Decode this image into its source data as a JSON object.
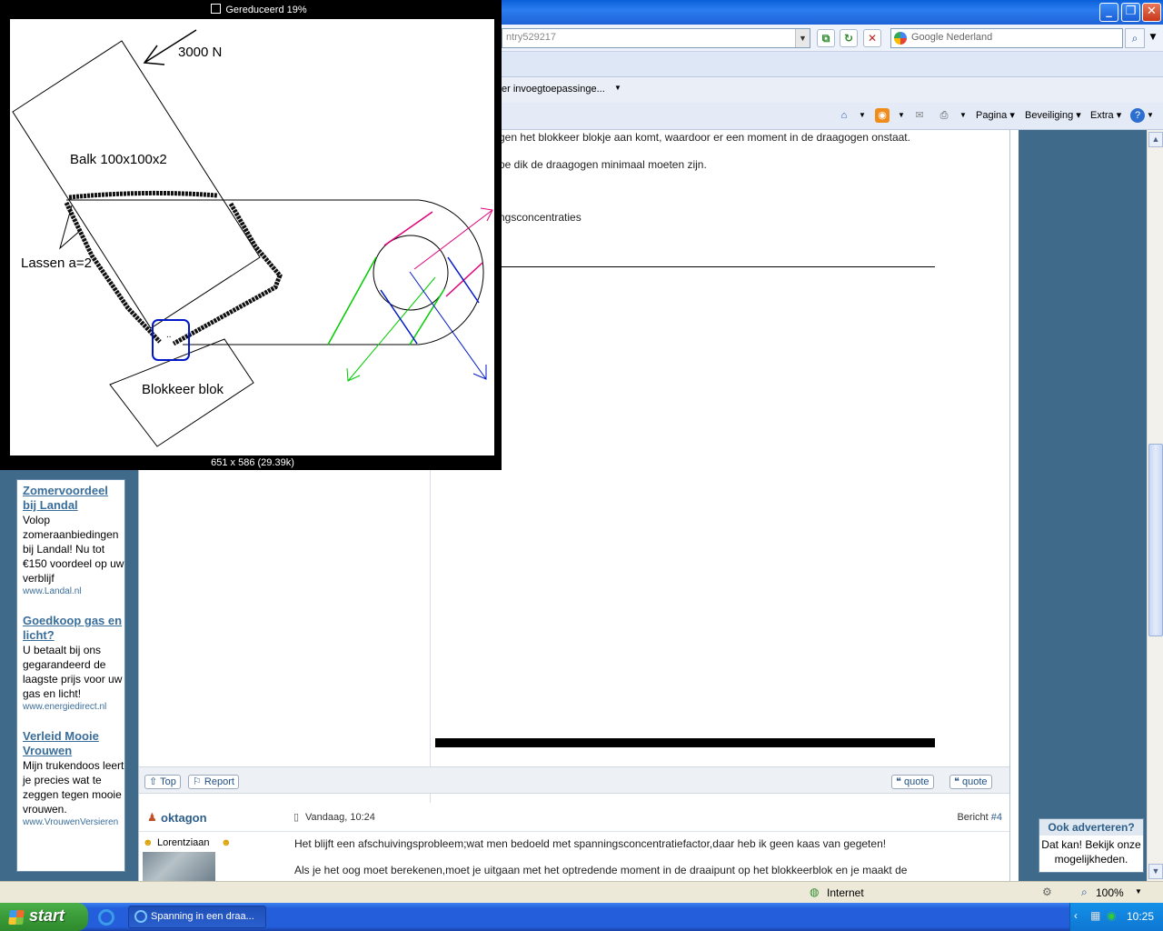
{
  "browser": {
    "address_fragment": "ntry529217",
    "search_placeholder": "Google Nederland",
    "favorites_fragment": "er invoegtoepassinge...",
    "toolbar": {
      "page": "Pagina",
      "security": "Beveiliging",
      "extra": "Extra"
    },
    "status_zone": "Internet",
    "zoom": "100%"
  },
  "post1": {
    "line1": "gen het blokkeer blokje aan komt, waardoor er een moment in de draagogen onstaat.",
    "line2": "oe dik de draagogen minimaal moeten zijn.",
    "line3": "ngsconcentraties",
    "buttons": {
      "top": "Top",
      "report": "Report",
      "quote1": "quote",
      "quote2": "quote"
    }
  },
  "post2": {
    "author": "oktagon",
    "date": "Vandaag, 10:24",
    "number_prefix": "Bericht ",
    "number": "#4",
    "rank": "Lorentziaan",
    "text1": "Het blijft een afschuivingsprobleem;wat men bedoeld met spanningsconcentratiefactor,daar heb ik geen kaas van gegeten!",
    "text2": "Als je het oog moet berekenen,moet je uitgaan met het optredende moment in de draaipunt op het blokkeerblok en je maakt de"
  },
  "ads": [
    {
      "title": "Zomervoordeel bij Landal",
      "text": "Volop zomeraanbiedingen bij Landal! Nu tot €150 voordeel op uw verblijf",
      "url": "www.Landal.nl"
    },
    {
      "title": "Goedkoop gas en licht?",
      "text": "U betaalt bij ons gegarandeerd de laagste prijs voor uw gas en licht!",
      "url": "www.energiedirect.nl"
    },
    {
      "title": "Verleid Mooie Vrouwen",
      "text": "Mijn trukendoos leert je precies wat te zeggen tegen mooie vrouwen.",
      "url": "www.VrouwenVersieren"
    }
  ],
  "advertise": {
    "title": "Ook adverteren?",
    "text": "Dat kan! Bekijk onze mogelijkheden."
  },
  "popup": {
    "title": "Gereduceerd 19%",
    "footer": "651 x 586 (29.39k)",
    "labels": {
      "force": "3000 N",
      "beam": "Balk 100x100x2",
      "welds": "Lassen a=2",
      "block": "Blokkeer blok",
      "dots": ".."
    }
  },
  "taskbar": {
    "start": "start",
    "task": "Spanning in een draa...",
    "clock": "10:25"
  },
  "colors": {
    "ie_blue": "#245edb",
    "forum_sidebar": "#3f6a8a",
    "link": "#3a6e9a",
    "diagram_green": "#00cc00",
    "diagram_magenta": "#e0007a",
    "diagram_blue": "#0018c8"
  }
}
